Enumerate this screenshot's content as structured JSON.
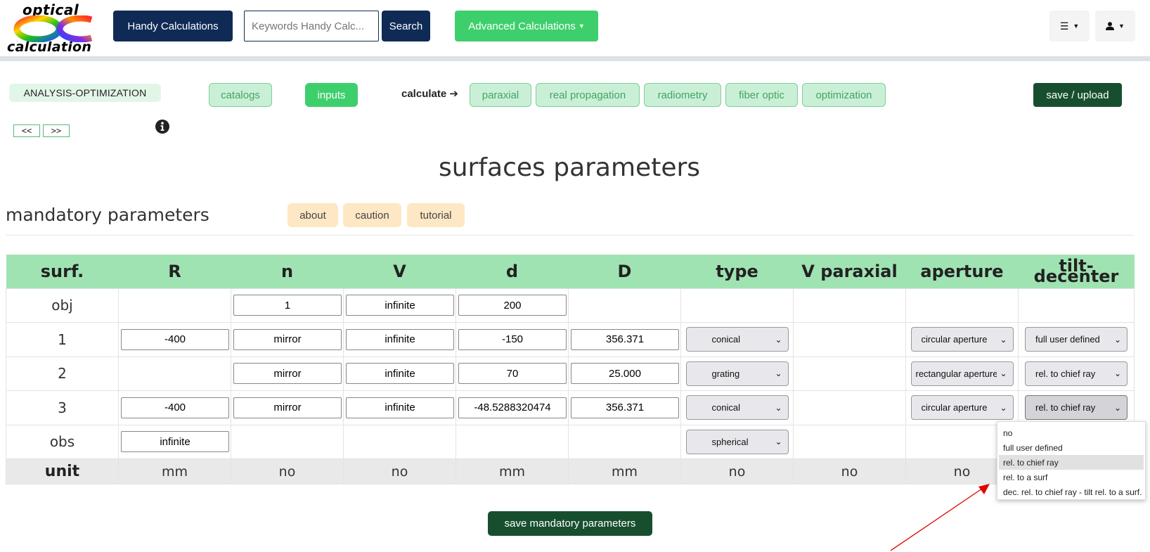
{
  "header": {
    "logo_top": "optical",
    "logo_bottom": "calculation",
    "handy_label": "Handy Calculations",
    "search_placeholder": "Keywords Handy Calc...",
    "search_label": "Search",
    "advanced_label": "Advanced Calculations",
    "menu_icon": "bars-icon",
    "user_icon": "user-icon"
  },
  "toolbar": {
    "analysis_label": "Analysis-optimization",
    "catalogs": "catalogs",
    "inputs": "inputs",
    "calculate": "calculate",
    "calc_items": [
      "paraxial",
      "real propagation",
      "radiometry",
      "fiber optic",
      "optimization"
    ],
    "save_upload": "save / upload",
    "prev": "<<",
    "next": ">>"
  },
  "page_title": "surfaces parameters",
  "section_title": "mandatory parameters",
  "doc_buttons": [
    "about",
    "caution",
    "tutorial"
  ],
  "table": {
    "headers": [
      "surf.",
      "R",
      "n",
      "V",
      "d",
      "D",
      "type",
      "V paraxial",
      "aperture"
    ],
    "tilt_header_1": "tilt-",
    "tilt_header_2": "decenter",
    "rows": [
      {
        "surf": "obj",
        "R": null,
        "n": "1",
        "V": "infinite",
        "d": "200",
        "D": null,
        "type": null,
        "aperture": null,
        "tilt": null
      },
      {
        "surf": "1",
        "R": "-400",
        "n": "mirror",
        "V": "infinite",
        "d": "-150",
        "D": "356.371",
        "type": "conical",
        "aperture": "circular aperture",
        "tilt": "full user defined"
      },
      {
        "surf": "2",
        "R": null,
        "n": "mirror",
        "V": "infinite",
        "d": "70",
        "D": "25.000",
        "type": "grating",
        "aperture": "rectangular aperture",
        "tilt": "rel. to chief ray"
      },
      {
        "surf": "3",
        "R": "-400",
        "n": "mirror",
        "V": "infinite",
        "d": "-48.5288320474",
        "D": "356.371",
        "type": "conical",
        "aperture": "circular aperture",
        "tilt": "rel. to chief ray"
      },
      {
        "surf": "obs",
        "R": "infinite",
        "n": null,
        "V": null,
        "d": null,
        "D": null,
        "type": "spherical",
        "aperture": null,
        "tilt": null
      }
    ],
    "units": [
      "unit",
      "mm",
      "no",
      "no",
      "mm",
      "mm",
      "no",
      "no",
      "no"
    ]
  },
  "tilt_dropdown": {
    "options": [
      "no",
      "full user defined",
      "rel. to chief ray",
      "rel. to a surf",
      "dec. rel. to chief ray - tilt rel. to a surf."
    ],
    "selected": "rel. to chief ray"
  },
  "save_mandatory": "save mandatory parameters",
  "colors": {
    "navy": "#0f2b55",
    "green": "#3ecf6d",
    "dark_green": "#174f2e",
    "table_header": "#a0e3b2",
    "doc_button": "#fde7c4",
    "annotation_arrow": "#e00000"
  }
}
